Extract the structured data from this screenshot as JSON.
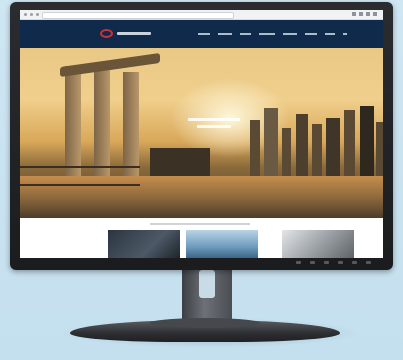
{
  "image": {
    "subject": "desktop-monitor",
    "stand": "height-adjustable",
    "screen_content": "corporate-website",
    "colors": {
      "background": "#c8e2f1",
      "bezel": "#1b1c1e",
      "nav_bar": "#0f2a4a",
      "logo_accent": "#c8323a",
      "hero_sky": "#f0cf8c"
    }
  }
}
